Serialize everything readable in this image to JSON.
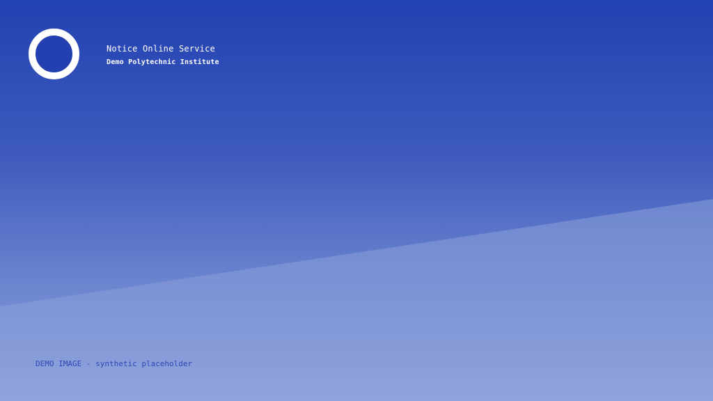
{
  "header": {
    "title": "Notice Online Service",
    "subtitle": "Demo Polytechnic Institute",
    "logo_icon": "circle-ring-icon"
  },
  "footer": {
    "caption": "DEMO IMAGE - synthetic placeholder"
  },
  "colors": {
    "primary": "#2241b1",
    "light_band": "#8ea1dc",
    "white": "#ffffff",
    "caption": "#2f46b3"
  }
}
